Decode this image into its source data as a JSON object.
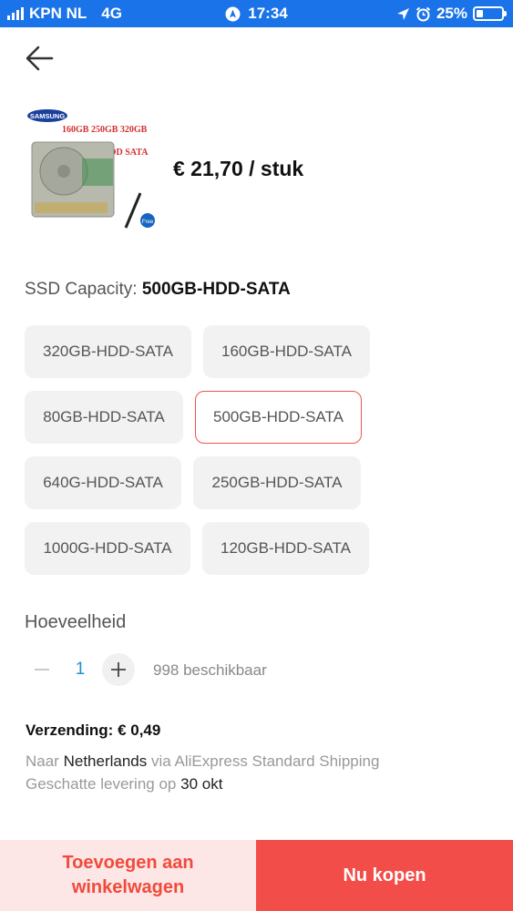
{
  "status_bar": {
    "carrier": "KPN NL",
    "network": "4G",
    "time": "17:34",
    "battery": "25%",
    "battery_level": 0.25,
    "icons": [
      "signal-bars-icon",
      "location-icon",
      "alarm-icon",
      "battery-icon"
    ]
  },
  "product": {
    "image_labels": {
      "brand": "SAMSUNG",
      "sizes": "160GB 250GB 320GB",
      "type": "2.5HDD SATA",
      "badge": "Free"
    },
    "price": "€ 21,70 / stuk"
  },
  "option": {
    "label": "SSD Capacity:",
    "selected": "500GB-HDD-SATA",
    "choices": [
      "320GB-HDD-SATA",
      "160GB-HDD-SATA",
      "80GB-HDD-SATA",
      "500GB-HDD-SATA",
      "640G-HDD-SATA",
      "250GB-HDD-SATA",
      "1000G-HDD-SATA",
      "120GB-HDD-SATA"
    ]
  },
  "quantity": {
    "label": "Hoeveelheid",
    "value": "1",
    "available": "998 beschikbaar"
  },
  "shipping": {
    "title": "Verzending: € 0,49",
    "to_prefix": "Naar",
    "country": "Netherlands",
    "via": "via AliExpress Standard Shipping",
    "delivery_prefix": "Geschatte levering op",
    "delivery_day": "30",
    "delivery_month": "okt"
  },
  "actions": {
    "add_to_cart": "Toevoegen aan winkelwagen",
    "buy_now": "Nu kopen"
  },
  "colors": {
    "status_bar": "#1a73e8",
    "accent": "#f24d49",
    "selected_border": "#ef5350",
    "quantity": "#1f8fd6"
  }
}
